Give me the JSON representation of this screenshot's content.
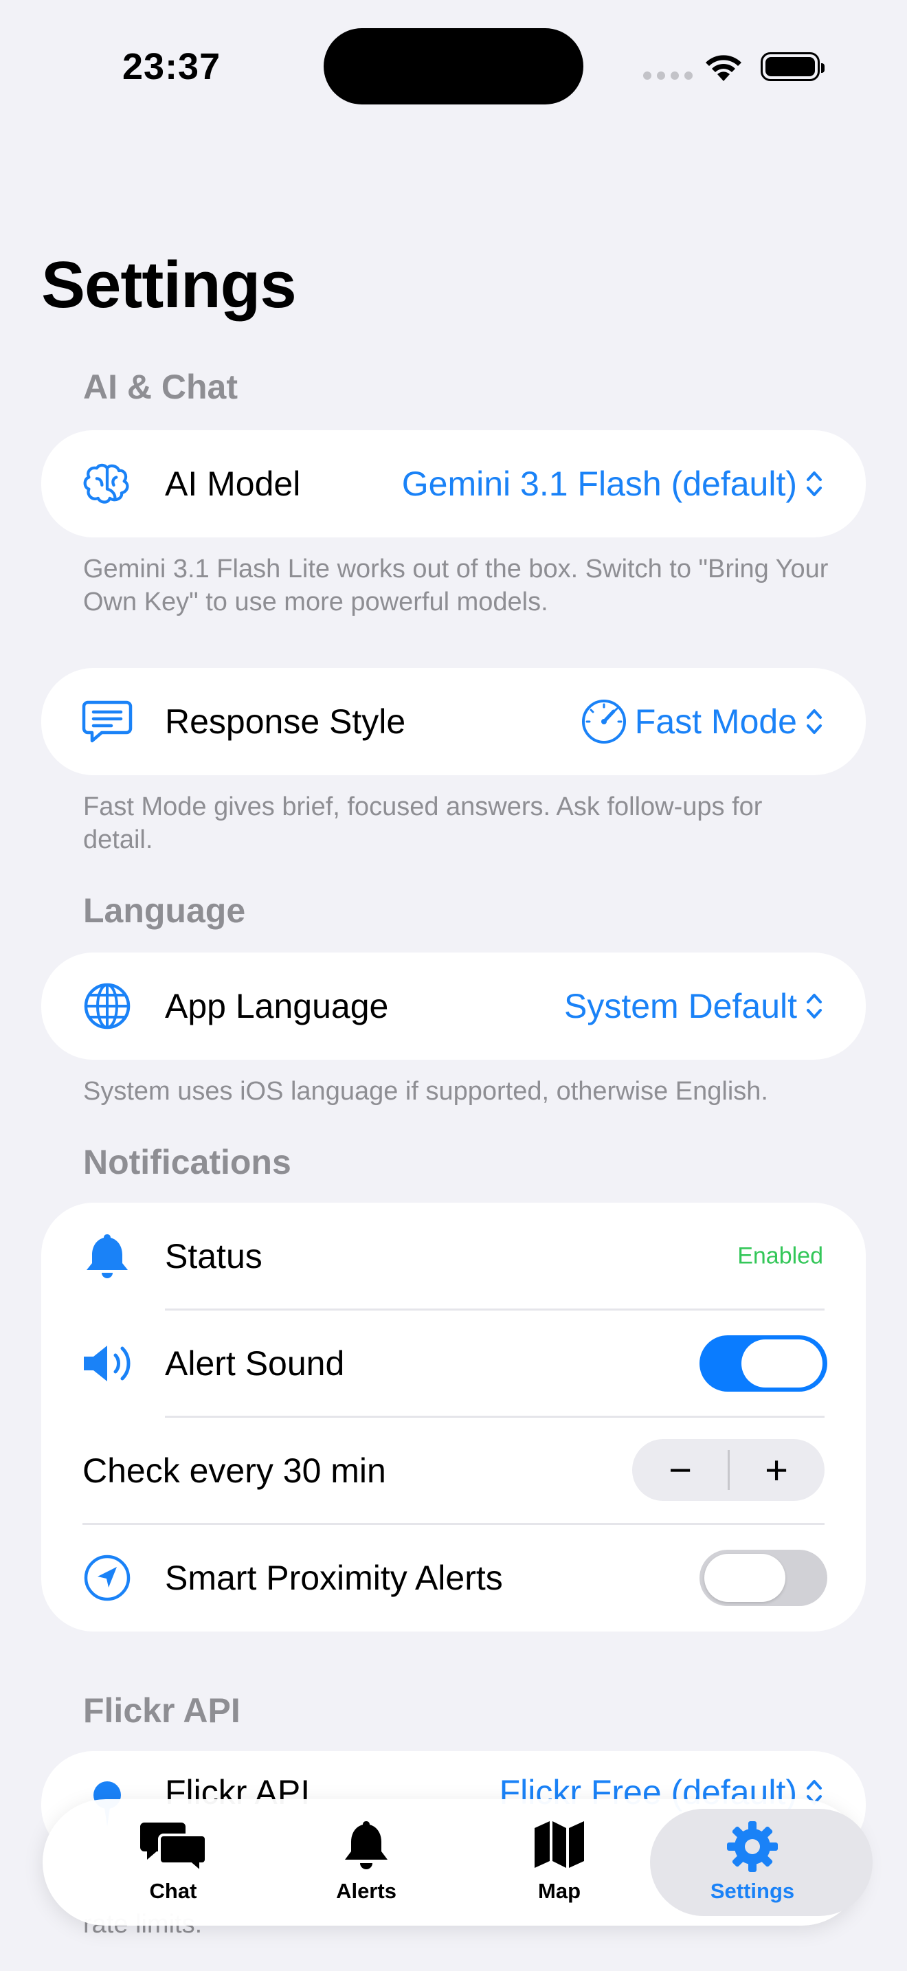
{
  "status_bar": {
    "time": "23:37"
  },
  "page": {
    "title": "Settings"
  },
  "sections": {
    "ai_chat": {
      "header": "AI & Chat",
      "ai_model": {
        "label": "AI Model",
        "value": "Gemini 3.1 Flash (default)",
        "icon": "brain-icon"
      },
      "ai_model_footnote": "Gemini 3.1 Flash Lite works out of the box. Switch to \"Bring Your Own Key\" to use more powerful models.",
      "response_style": {
        "label": "Response Style",
        "value": "Fast Mode",
        "icon": "message-icon",
        "value_icon": "speedometer-icon"
      },
      "response_style_footnote": "Fast Mode gives brief, focused answers. Ask follow-ups for detail."
    },
    "language": {
      "header": "Language",
      "app_language": {
        "label": "App Language",
        "value": "System Default",
        "icon": "globe-icon"
      },
      "footnote": "System uses iOS language if supported, otherwise English."
    },
    "notifications": {
      "header": "Notifications",
      "status": {
        "label": "Status",
        "value": "Enabled",
        "icon": "bell-icon",
        "value_color": "#34c759"
      },
      "alert_sound": {
        "label": "Alert Sound",
        "icon": "speaker-icon",
        "on": true
      },
      "check_interval": {
        "label": "Check every 30 min",
        "minus": "−",
        "plus": "+"
      },
      "smart_proximity": {
        "label": "Smart Proximity Alerts",
        "icon": "location-arrow-icon",
        "on": false
      }
    },
    "flickr": {
      "header": "Flickr API",
      "flickr_api": {
        "label": "Flickr API",
        "value": "Flickr Free (default)",
        "icon": "pin-icon"
      },
      "footnote_partial": "rate limits."
    }
  },
  "tab_bar": {
    "tabs": [
      {
        "label": "Chat",
        "icon": "chat-bubbles-icon"
      },
      {
        "label": "Alerts",
        "icon": "bell-icon"
      },
      {
        "label": "Map",
        "icon": "map-icon"
      },
      {
        "label": "Settings",
        "icon": "gear-icon",
        "active": true
      }
    ]
  },
  "colors": {
    "accent": "#1a82f7",
    "toggle_on": "#0a7cff",
    "toggle_off": "#d1d1d6",
    "enabled_green": "#34c759",
    "background": "#f2f2f7"
  }
}
